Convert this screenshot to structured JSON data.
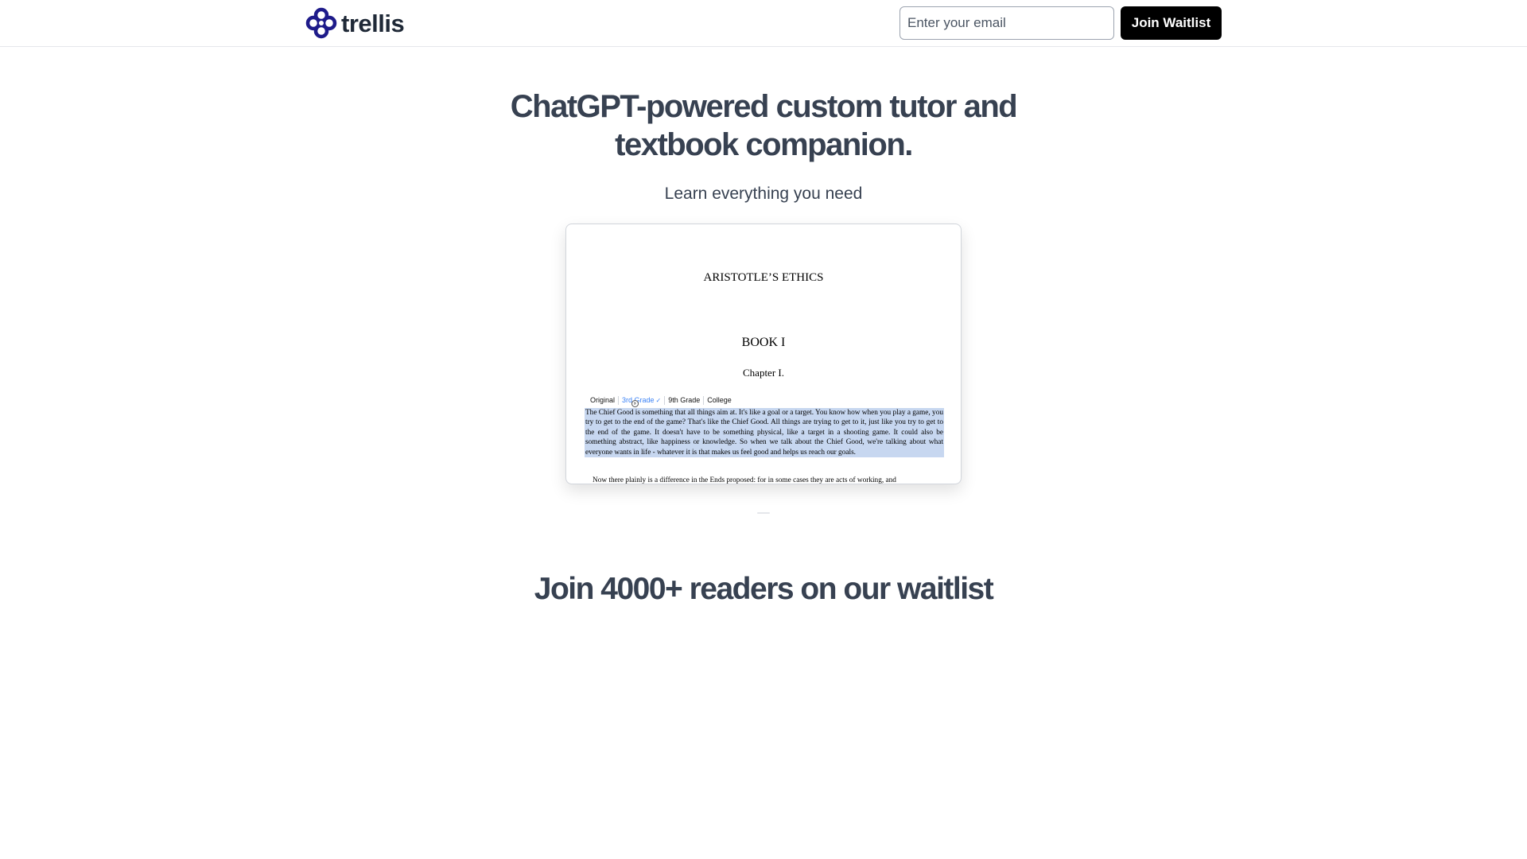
{
  "header": {
    "brand_name": "trellis",
    "logo_icon": "trellis-logo-icon",
    "brand_color": "#1e1b8a",
    "email_placeholder": "Enter your email",
    "email_value": "",
    "join_label": "Join Waitlist"
  },
  "hero": {
    "title": "ChatGPT-powered custom tutor and textbook companion.",
    "subtitle": "Learn everything you need"
  },
  "demo": {
    "doc_title": "ARISTOTLE’S ETHICS",
    "book": "BOOK I",
    "chapter": "Chapter I.",
    "levels": [
      "Original",
      "3rd Grade",
      "9th Grade",
      "College"
    ],
    "active_level": "3rd Grade",
    "highlight_color": "#c7d7f0",
    "highlighted_text": "The Chief Good is something that all things aim at. It's like a goal or a target. You know how when you play a game, you try to get to the end of the game? That's like the Chief Good. All things are trying to get to it, just like you try to get to the end of the game. It doesn't have to be something physical, like a target in a shooting game. It could also be something abstract, like happiness or knowledge. So when we talk about the Chief Good, we're talking about what everyone wants in life - whatever it is that makes us feel good and helps us reach our goals.",
    "next_text": "Now there plainly is a difference in the Ends proposed: for in some cases they are acts of working, and"
  },
  "waitlist": {
    "heading": "Join 4000+ readers on our waitlist"
  }
}
